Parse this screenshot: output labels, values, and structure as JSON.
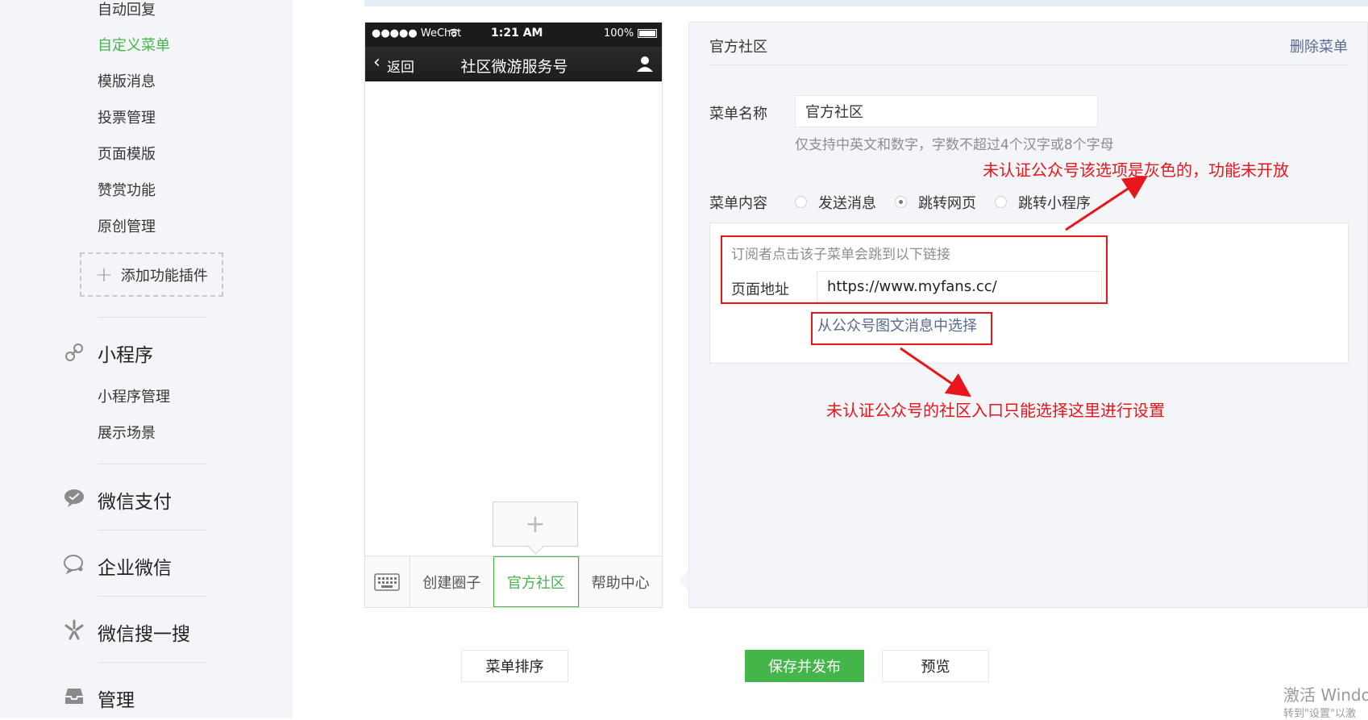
{
  "sidebar": {
    "subitems_top": [
      {
        "label": "自动回复",
        "active": false
      },
      {
        "label": "自定义菜单",
        "active": true
      },
      {
        "label": "模版消息",
        "active": false
      },
      {
        "label": "投票管理",
        "active": false
      },
      {
        "label": "页面模版",
        "active": false
      },
      {
        "label": "赞赏功能",
        "active": false
      },
      {
        "label": "原创管理",
        "active": false
      }
    ],
    "add_plugin_label": "添加功能插件",
    "mini_program": {
      "title": "小程序",
      "icon": "link-icon",
      "subitems": [
        "小程序管理",
        "展示场景"
      ]
    },
    "groups": [
      {
        "title": "微信支付",
        "icon": "wechat-pay-icon"
      },
      {
        "title": "企业微信",
        "icon": "work-wechat-icon"
      },
      {
        "title": "微信搜一搜",
        "icon": "search-sparkle-icon"
      },
      {
        "title": "管理",
        "icon": "inbox-icon"
      }
    ],
    "accent_color": "#44b549"
  },
  "phone": {
    "status": {
      "carrier": "●●●●● WeChat",
      "time": "1:21 AM",
      "battery": "100%"
    },
    "nav": {
      "back_label": "返回",
      "title": "社区微游服务号"
    },
    "menu_items": [
      {
        "label": "创建圈子",
        "active": false
      },
      {
        "label": "官方社区",
        "active": true
      },
      {
        "label": "帮助中心",
        "active": false
      }
    ]
  },
  "editor": {
    "header_title": "官方社区",
    "delete_label": "删除菜单",
    "name_label": "菜单名称",
    "name_value": "官方社区",
    "name_hint": "仅支持中英文和数字，字数不超过4个汉字或8个字母",
    "content_label": "菜单内容",
    "options": [
      {
        "label": "发送消息",
        "checked": false
      },
      {
        "label": "跳转网页",
        "checked": true
      },
      {
        "label": "跳转小程序",
        "checked": false
      }
    ],
    "link_desc": "订阅者点击该子菜单会跳到以下链接",
    "url_label": "页面地址",
    "url_value": "https://www.myfans.cc/",
    "select_from_article": "从公众号图文消息中选择"
  },
  "annotations": {
    "note_top": "未认证公众号该选项是灰色的，功能未开放",
    "note_bottom": "未认证公众号的社区入口只能选择这里进行设置"
  },
  "buttons": {
    "sort": "菜单排序",
    "save_publish": "保存并发布",
    "preview": "预览"
  },
  "watermark": {
    "line1": "激活 Windo",
    "line2": "转到\"设置\"以激"
  }
}
